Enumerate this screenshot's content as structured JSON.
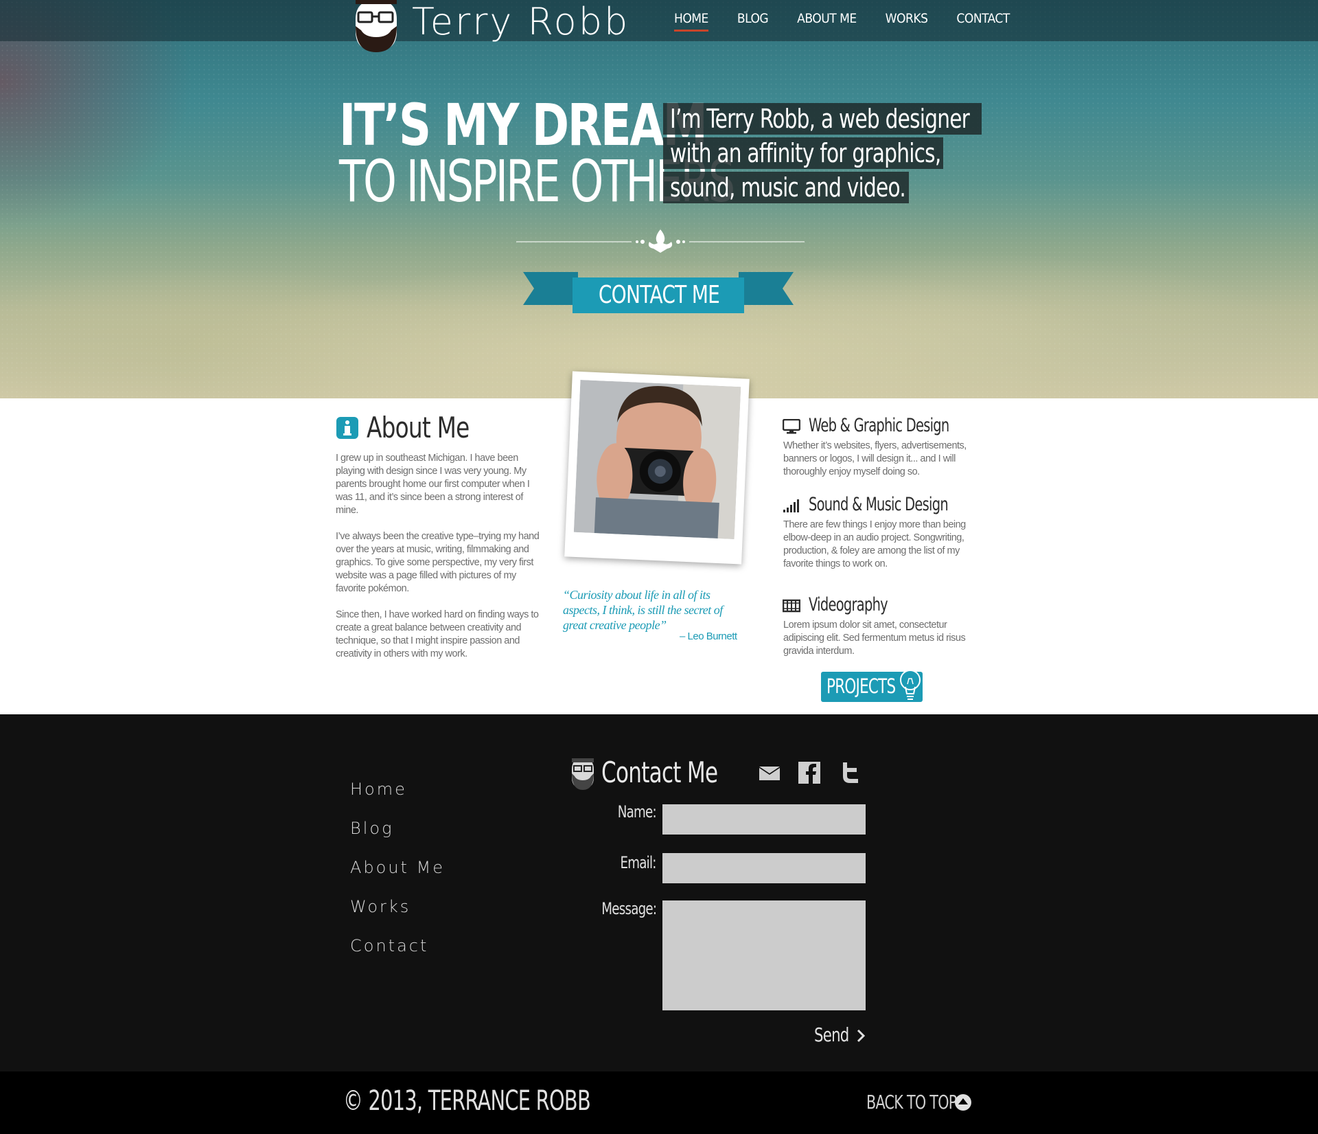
{
  "brand": {
    "name": "Terry Robb",
    "logo_icon": "bearded-head-logo-icon"
  },
  "nav": {
    "items": [
      "HOME",
      "BLOG",
      "ABOUT ME",
      "WORKS",
      "CONTACT"
    ],
    "active": "HOME",
    "accent_color": "#c8452a"
  },
  "hero": {
    "headline_line1": "IT’S MY DREAM",
    "headline_line2": "TO INSPIRE OTHERS",
    "intro_lines": [
      "I’m Terry Robb, a web designer",
      "with an affinity for graphics,",
      "sound, music and video."
    ],
    "cta_label": "CONTACT ME",
    "divider_icon": "fleur-de-lis-icon"
  },
  "about": {
    "title": "About Me",
    "icon": "info-icon",
    "paragraphs": [
      "I grew up in southeast Michigan. I have been playing with design since I was very young. My parents brought home our first computer when I was 11, and it’s since been a strong interest of mine.",
      "I’ve always been the creative type–trying my hand over the years at music, writing, filmmaking and graphics. To give some perspective, my very first website was a page filled with pictures of my favorite pokémon.",
      "Since then, I have worked hard on finding ways to create a great balance between creativity and technique, so that I might inspire passion and creativity in others with my work."
    ]
  },
  "quote": {
    "text": "“Curiosity about life in all of its aspects, I think, is still the secret of great creative people”",
    "author": "– Leo Burnett"
  },
  "services": [
    {
      "title": "Web & Graphic Design",
      "icon": "monitor-icon",
      "text": "Whether it’s websites, flyers, advertisements, banners or logos, I will design it... and I will thoroughly enjoy myself doing so."
    },
    {
      "title": "Sound & Music Design",
      "icon": "signal-bars-icon",
      "text": "There are few things I enjoy more than being elbow-deep in an audio project. Songwriting, production, & foley are among the list of my favorite things to work on."
    },
    {
      "title": "Videography",
      "icon": "film-strip-icon",
      "text": "Lorem ipsum dolor sit amet, consectetur adipiscing elit. Sed fermentum metus id risus gravida interdum."
    }
  ],
  "projects_button": {
    "label": "PROJECTS",
    "icon": "lightbulb-icon"
  },
  "footer": {
    "nav": [
      "Home",
      "Blog",
      "About Me",
      "Works",
      "Contact"
    ],
    "contact_title": "Contact Me",
    "social_icons": [
      "mail-icon",
      "facebook-icon",
      "twitter-icon"
    ],
    "form": {
      "name_label": "Name:",
      "email_label": "Email:",
      "message_label": "Message:",
      "name_value": "",
      "email_value": "",
      "message_value": "",
      "send_label": "Send"
    },
    "copyright": "© 2013, TERRANCE ROBB",
    "back_to_top": "BACK TO TOP"
  },
  "colors": {
    "accent": "#1c9bb5",
    "footer_bg": "#111111",
    "field_bg": "#cccccc"
  }
}
